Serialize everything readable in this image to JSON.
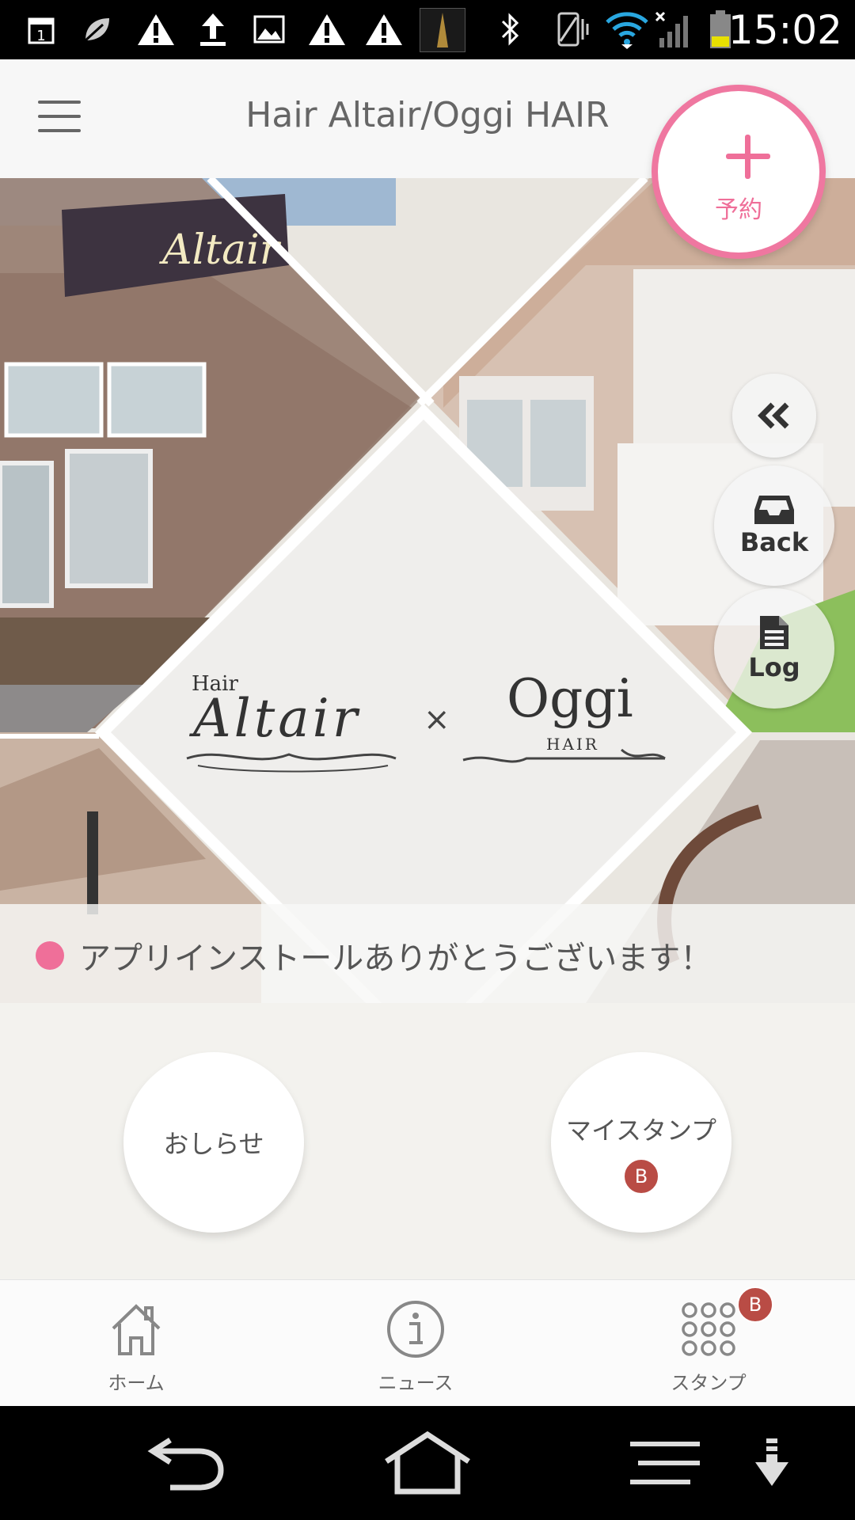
{
  "status_bar": {
    "time": "15:02",
    "left_icons": [
      "calendar-icon",
      "leaf-icon",
      "warning-icon",
      "upload-icon",
      "image-icon",
      "warning-icon",
      "warning-icon",
      "manhattan-app-icon"
    ],
    "right_icons": [
      "bluetooth-icon",
      "vibrate-icon",
      "wifi-icon",
      "signal-icon",
      "battery-icon"
    ]
  },
  "header": {
    "title": "Hair Altair/Oggi HAIR",
    "menu_icon": "hamburger-icon"
  },
  "hero": {
    "logo_left": {
      "small": "Hair",
      "main": "Altair"
    },
    "logo_join": "×",
    "logo_right": {
      "main": "Oggi",
      "small": "HAIR"
    },
    "sign_text": "Altair"
  },
  "reserve_button": {
    "label": "予約",
    "icon": "plus-icon"
  },
  "side_controls": {
    "collapse_icon": "double-chevron-left-icon",
    "back_label": "Back",
    "log_label": "Log"
  },
  "notice": {
    "text": "アプリインストールありがとうございます！",
    "dot_color": "#ef6f99"
  },
  "buttons": {
    "news_label": "おしらせ",
    "stamp_label": "マイスタンプ",
    "stamp_badge": "B"
  },
  "tabs": [
    {
      "label": "ホーム",
      "icon": "home-icon"
    },
    {
      "label": "ニュース",
      "icon": "info-icon"
    },
    {
      "label": "スタンプ",
      "icon": "stamp-grid-icon",
      "badge": "B"
    }
  ],
  "colors": {
    "accent": "#ef6f99",
    "badge": "#b94c45"
  }
}
